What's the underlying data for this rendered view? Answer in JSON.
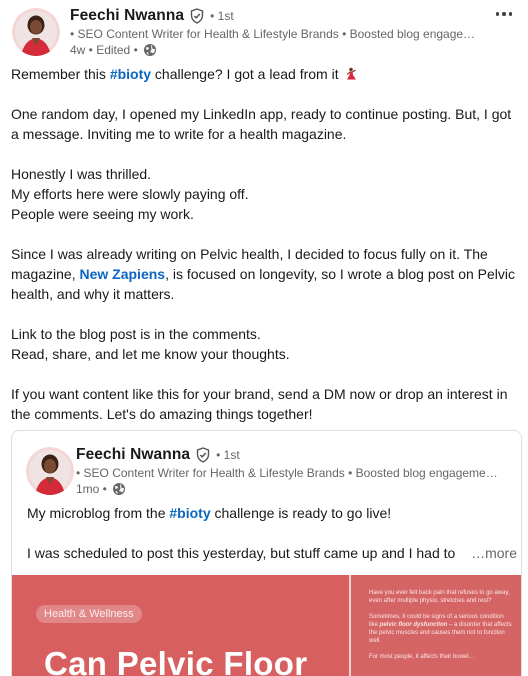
{
  "post": {
    "author": {
      "name": "Feechi Nwanna",
      "degree": "• 1st",
      "headline": "• SEO Content Writer for Health & Lifestyle Brands • Boosted blog engage…",
      "time": "4w • Edited •"
    },
    "body": {
      "p1_before": "Remember this ",
      "p1_hashtag": "#bioty",
      "p1_after": " challenge? I got a lead from it ",
      "p2": "One random day, I opened my LinkedIn app, ready to continue posting. But, I got a message. Inviting me to write for a health magazine.",
      "p3_l1": "Honestly I was thrilled.",
      "p3_l2": "My efforts here were slowly paying off.",
      "p3_l3": "People were seeing my work.",
      "p4_before": "Since I was already writing on Pelvic health, I decided to focus fully on it. The magazine, ",
      "p4_mention": "New Zapiens",
      "p4_after": ", is focused on longevity, so I wrote a blog post on Pelvic health, and why it matters.",
      "p5_l1": "Link to the blog post is in the comments.",
      "p5_l2": "Read, share, and let me know your thoughts.",
      "p6": "If you want content like this for your brand, send a DM now or drop an interest in the comments. Let's do amazing things together!"
    }
  },
  "reshare": {
    "author": {
      "name": "Feechi Nwanna",
      "degree": "• 1st",
      "headline": "• SEO Content Writer for Health & Lifestyle Brands • Boosted blog engageme…",
      "time": "1mo •"
    },
    "text_before": "My microblog from the ",
    "text_hashtag": "#bioty",
    "text_after": " challenge is ready to go live!",
    "text_line2": "I was scheduled to post this yesterday, but stuff came up and I had to",
    "see_more": "…more",
    "image": {
      "tag": "Health & Wellness",
      "title": "Can Pelvic Floor",
      "side_p1": "Have you ever felt back pain that refuses to go away, even after multiple physio, stretches and rest?",
      "side_p2_before": "Sometimes, it could be signs of a serious condition like ",
      "side_p2_em": "pelvic floor dysfunction",
      "side_p2_after": " – a disorder that affects the pelvic muscles and causes them not to function well.",
      "side_p3": "For most people, it affects their bowel…"
    }
  },
  "colors": {
    "accent": "#0a66c2",
    "brand_red": "#d75f5f"
  }
}
